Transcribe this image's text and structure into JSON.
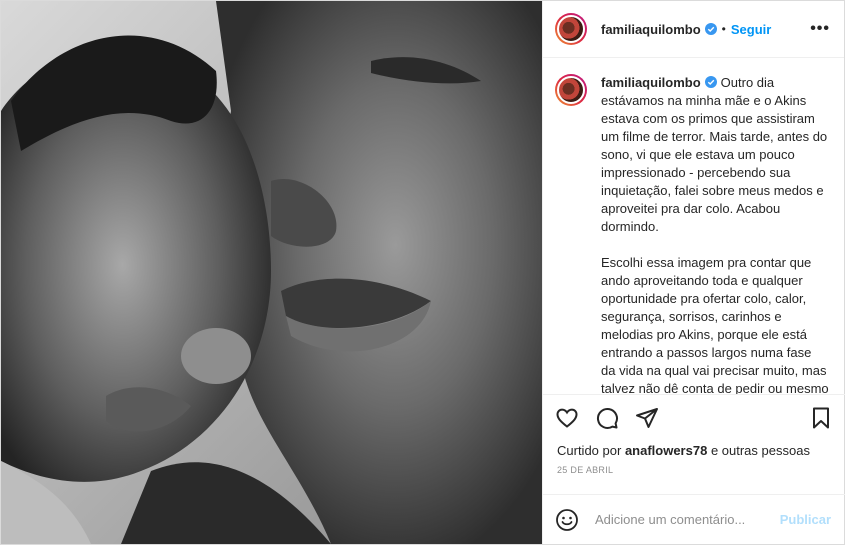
{
  "post": {
    "username": "familiaquilombo",
    "follow_separator": "•",
    "follow_label": "Seguir",
    "more_label": "•••",
    "caption_paragraph_1": "Outro dia estávamos na minha mãe e o Akins estava com os primos que assistiram um filme de terror. Mais tarde, antes do sono, vi que ele estava um pouco impressionado - percebendo sua inquietação, falei sobre meus medos e aproveitei pra dar colo. Acabou dormindo.",
    "caption_paragraph_2": "Escolhi essa imagem pra contar que ando aproveitando toda e qualquer oportunidade pra ofertar colo, calor, segurança, sorrisos, carinhos e melodias pro Akins, porque ele está entrando a passos largos numa fase da vida na qual vai precisar muito, mas talvez não dê conta de pedir ou mesmo de receber isto. Quero que meu amor fique impresso nele de tal forma que ele",
    "liked_prefix": "Curtido por",
    "liked_user": "anaflowers78",
    "liked_suffix": "e outras pessoas",
    "date": "25 DE ABRIL",
    "comment_placeholder": "Adicione um comentário...",
    "publish_label": "Publicar"
  },
  "icons": {
    "verified": "verified-badge-icon",
    "like": "heart-icon",
    "comment": "comment-bubble-icon",
    "share": "paper-plane-icon",
    "save": "bookmark-icon",
    "emoji": "smiley-icon",
    "more": "more-options-icon"
  },
  "colors": {
    "accent": "#0095f6",
    "publish_disabled": "#b2dffc",
    "verified": "#3897f0",
    "muted": "#8e8e8e",
    "border": "#dbdbdb"
  }
}
